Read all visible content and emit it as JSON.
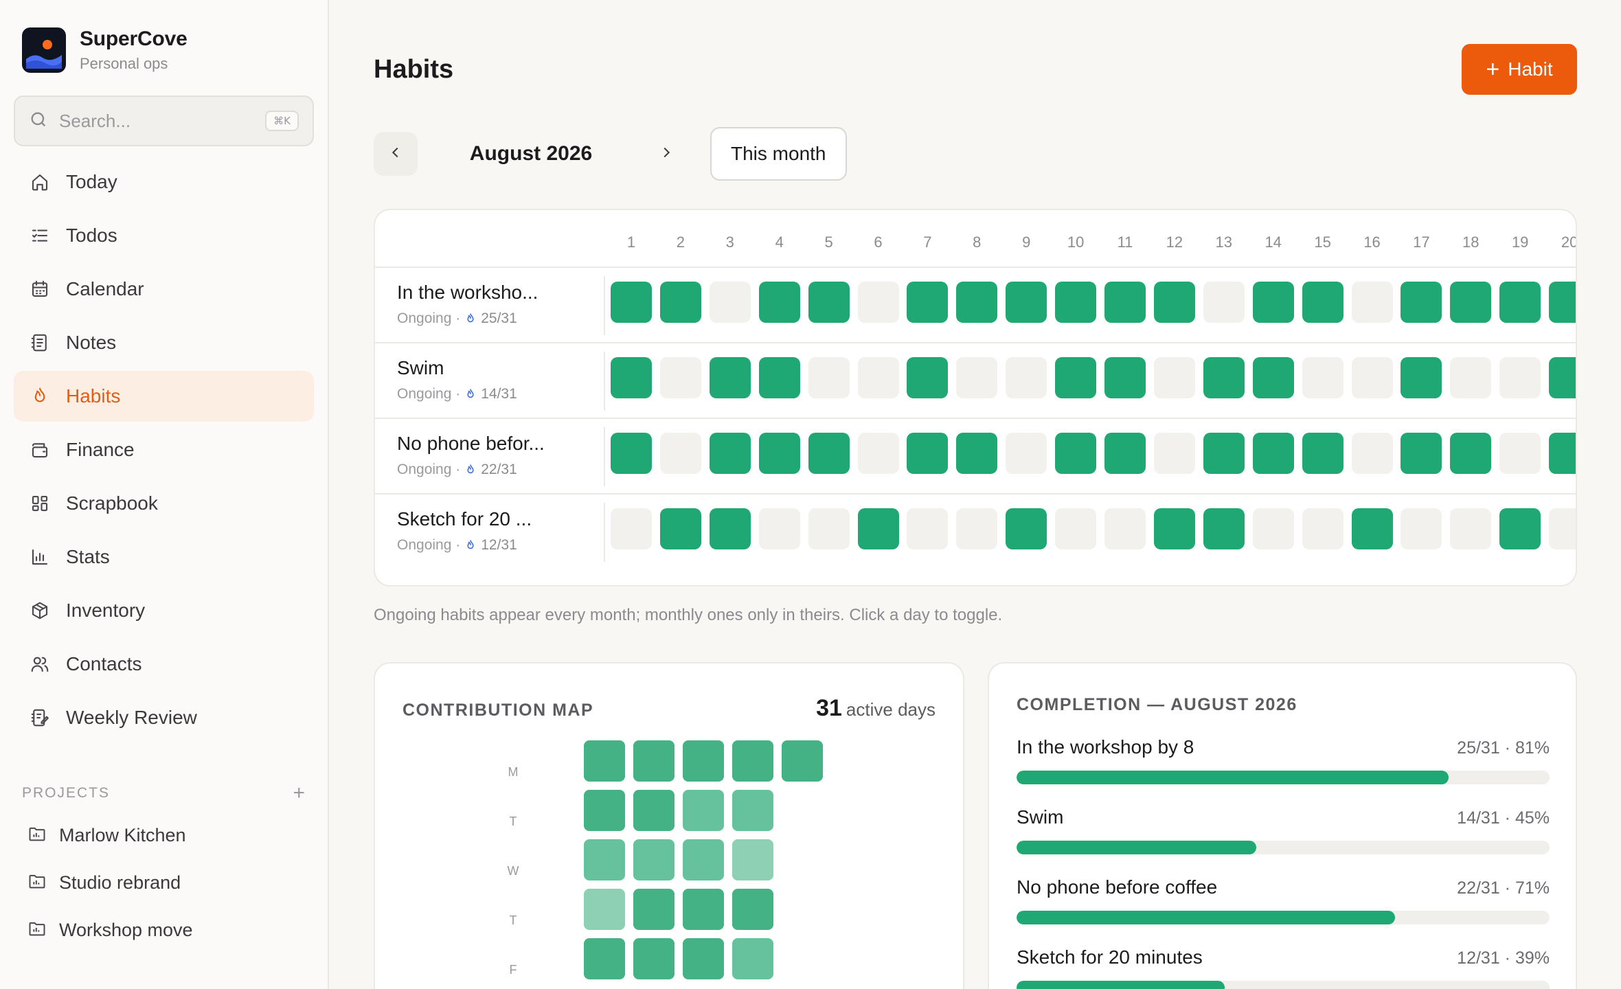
{
  "app": {
    "name": "SuperCove",
    "subtitle": "Personal ops"
  },
  "search": {
    "placeholder": "Search...",
    "shortcut": "⌘K"
  },
  "nav": [
    {
      "label": "Today",
      "icon": "home-icon"
    },
    {
      "label": "Todos",
      "icon": "checklist-icon"
    },
    {
      "label": "Calendar",
      "icon": "calendar-icon"
    },
    {
      "label": "Notes",
      "icon": "notes-icon"
    },
    {
      "label": "Habits",
      "icon": "flame-icon",
      "active": true
    },
    {
      "label": "Finance",
      "icon": "wallet-icon"
    },
    {
      "label": "Scrapbook",
      "icon": "grid-icon"
    },
    {
      "label": "Stats",
      "icon": "bar-chart-icon"
    },
    {
      "label": "Inventory",
      "icon": "box-icon"
    },
    {
      "label": "Contacts",
      "icon": "users-icon"
    },
    {
      "label": "Weekly Review",
      "icon": "review-icon"
    }
  ],
  "projects": {
    "title": "PROJECTS",
    "items": [
      {
        "label": "Marlow Kitchen"
      },
      {
        "label": "Studio rebrand"
      },
      {
        "label": "Workshop move"
      }
    ]
  },
  "page": {
    "title": "Habits",
    "add_label": "Habit"
  },
  "month_nav": {
    "label": "August 2026",
    "this_month_label": "This month"
  },
  "days": [
    "1",
    "2",
    "3",
    "4",
    "5",
    "6",
    "7",
    "8",
    "9",
    "10",
    "11",
    "12",
    "13",
    "14",
    "15",
    "16",
    "17",
    "18",
    "19",
    "20"
  ],
  "habits": [
    {
      "name": "In the worksho...",
      "type": "Ongoing ·",
      "count": "25/31",
      "days": [
        1,
        1,
        0,
        1,
        1,
        0,
        1,
        1,
        1,
        1,
        1,
        1,
        0,
        1,
        1,
        0,
        1,
        1,
        1,
        1
      ]
    },
    {
      "name": "Swim",
      "type": "Ongoing ·",
      "count": "14/31",
      "days": [
        1,
        0,
        1,
        1,
        0,
        0,
        1,
        0,
        0,
        1,
        1,
        0,
        1,
        1,
        0,
        0,
        1,
        0,
        0,
        1
      ]
    },
    {
      "name": "No phone befor...",
      "type": "Ongoing ·",
      "count": "22/31",
      "days": [
        1,
        0,
        1,
        1,
        1,
        0,
        1,
        1,
        0,
        1,
        1,
        0,
        1,
        1,
        1,
        0,
        1,
        1,
        0,
        1
      ]
    },
    {
      "name": "Sketch for 20 ...",
      "type": "Ongoing ·",
      "count": "12/31",
      "days": [
        0,
        1,
        1,
        0,
        0,
        1,
        0,
        0,
        1,
        0,
        0,
        1,
        1,
        0,
        0,
        1,
        0,
        0,
        1,
        0
      ]
    }
  ],
  "hint": "Ongoing habits appear every month; monthly ones only in theirs. Click a day to toggle.",
  "contribution": {
    "title": "CONTRIBUTION MAP",
    "active_count": "31",
    "active_label": "active days",
    "weekdays": [
      "M",
      "T",
      "W",
      "T",
      "F"
    ],
    "levels": [
      [
        4,
        4,
        4,
        4,
        4
      ],
      [
        4,
        4,
        3,
        3
      ],
      [
        3,
        3,
        3,
        2
      ],
      [
        2,
        4,
        4,
        4
      ],
      [
        4,
        4,
        4,
        3
      ]
    ]
  },
  "completion": {
    "title": "COMPLETION — AUGUST 2026",
    "items": [
      {
        "name": "In the workshop by 8",
        "value": "25/31 · 81%",
        "pct": 81
      },
      {
        "name": "Swim",
        "value": "14/31 · 45%",
        "pct": 45
      },
      {
        "name": "No phone before coffee",
        "value": "22/31 · 71%",
        "pct": 71
      },
      {
        "name": "Sketch for 20 minutes",
        "value": "12/31 · 39%",
        "pct": 39
      }
    ]
  },
  "colors": {
    "accent": "#ec5a0c",
    "green": "#1fa874",
    "empty": "#f2f1ed"
  }
}
